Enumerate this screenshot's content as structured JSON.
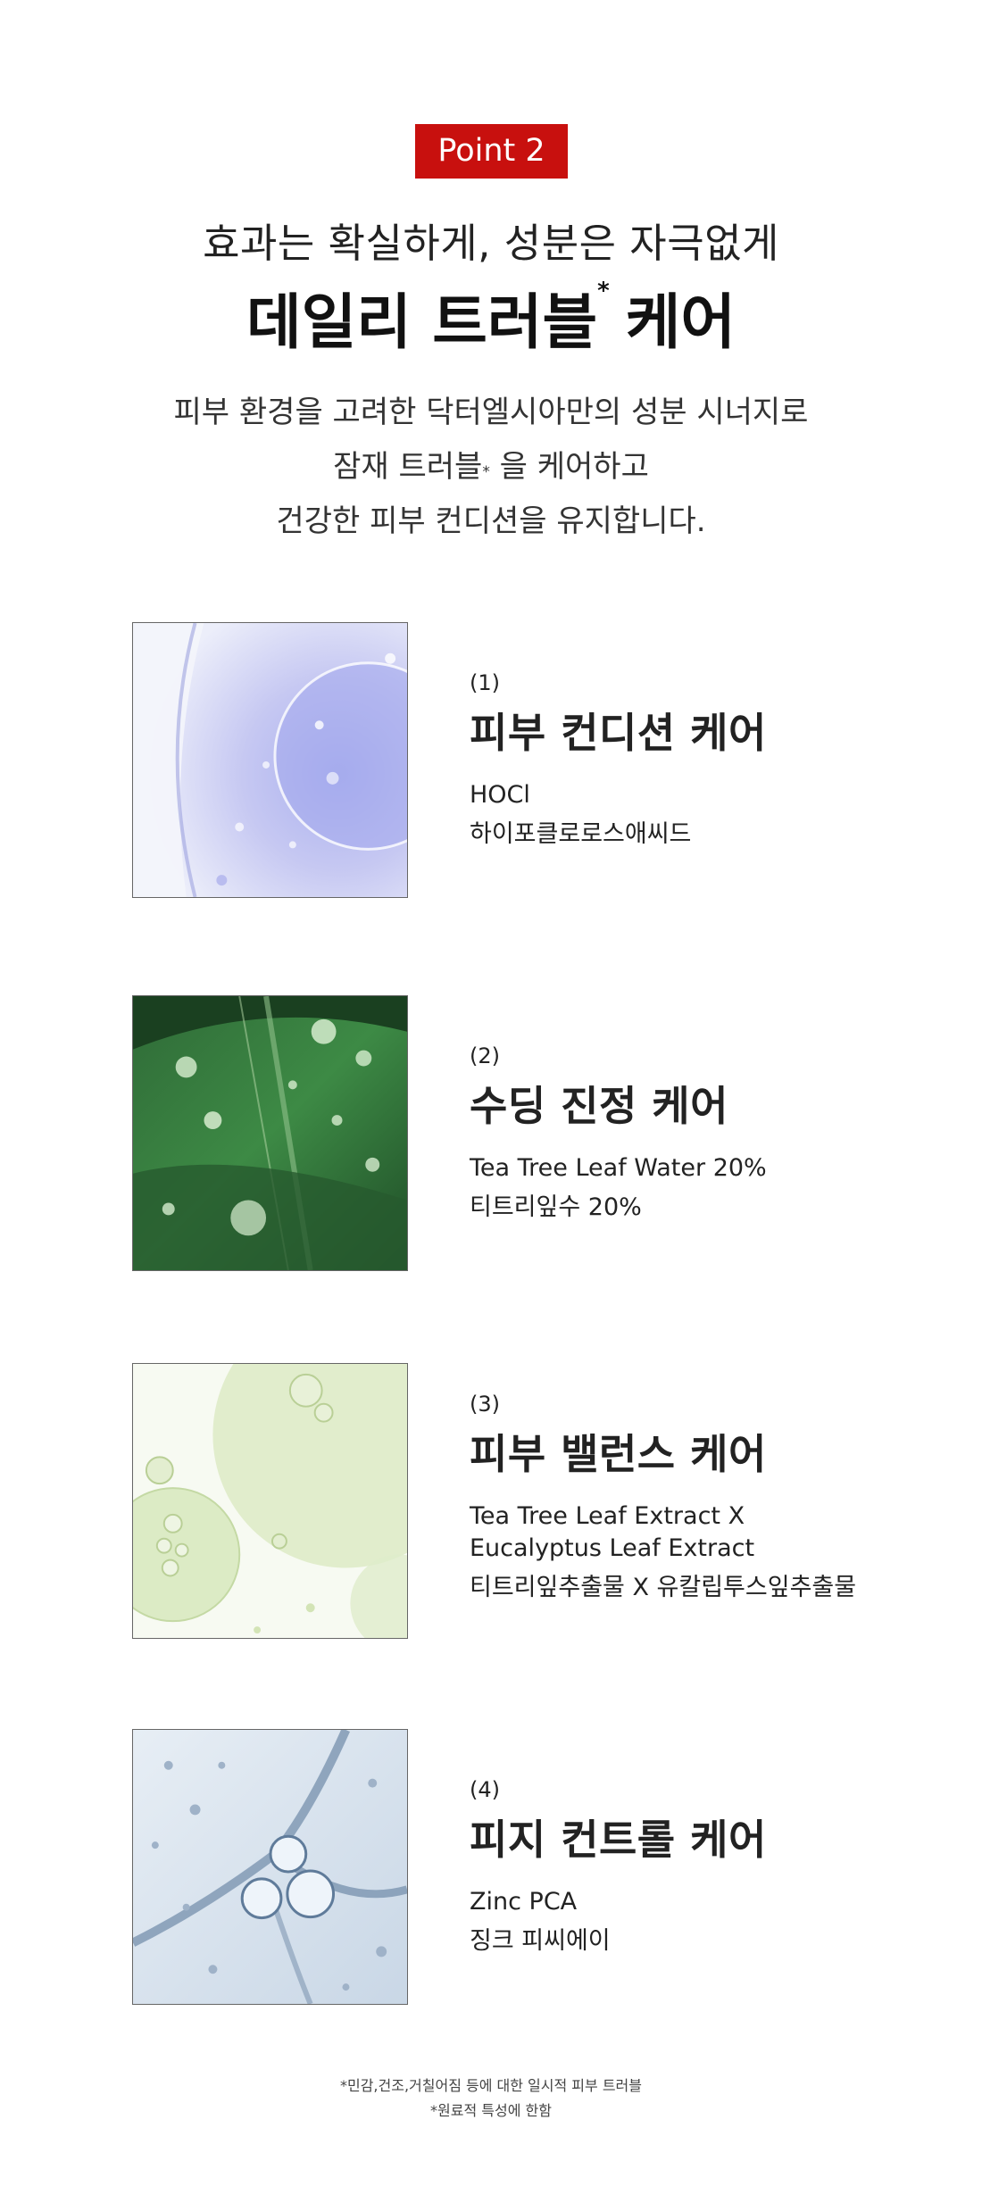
{
  "badge": "Point 2",
  "subtitle": "효과는 확실하게, 성분은 자극없게",
  "title": {
    "main": "데일리 트러블",
    "mark": "*",
    "tail": "케어"
  },
  "description": {
    "line1": "피부 환경을 고려한 닥터엘시아만의 성분 시너지로",
    "line2_pre": "잠재 트러블",
    "line2_mark": "*",
    "line2_post": " 을 케어하고",
    "line3": "건강한 피부 컨디션을 유지합니다."
  },
  "items": [
    {
      "num": "(1)",
      "name": "피부 컨디션 케어",
      "en": "HOCl",
      "ko": "하이포클로로스애씨드",
      "image": "blue-gel-drop-image"
    },
    {
      "num": "(2)",
      "name": "수딩 진정 케어",
      "en": "Tea Tree Leaf Water 20%",
      "ko": "티트리잎수 20%",
      "image": "green-leaf-water-drops-image"
    },
    {
      "num": "(3)",
      "name": "피부 밸런스 케어",
      "en": "Tea Tree Leaf Extract X",
      "en2": "Eucalyptus Leaf Extract",
      "ko": "티트리잎추출물 X 유칼립투스잎추출물",
      "image": "green-oil-bubbles-image"
    },
    {
      "num": "(4)",
      "name": "피지 컨트롤 케어",
      "en": "Zinc PCA",
      "ko": "징크 피씨에이",
      "image": "clear-gel-bubbles-image"
    }
  ],
  "footnotes": {
    "line1": "*민감,건조,거칠어짐 등에 대한 일시적 피부 트러블",
    "line2": "*원료적 특성에 한함"
  },
  "colors": {
    "badge": "#c8100e",
    "text": "#222222"
  }
}
